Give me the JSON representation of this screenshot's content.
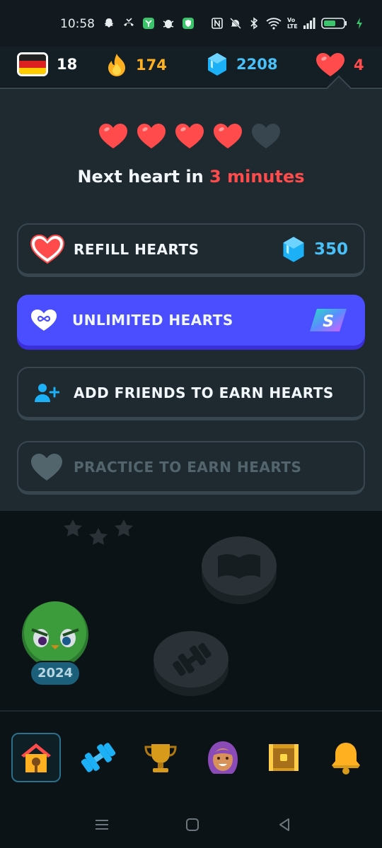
{
  "status_bar": {
    "time": "10:58",
    "lte_label": "Vo LTE"
  },
  "stats": {
    "course_flag": "German flag",
    "course_count": "18",
    "streak": "174",
    "gems": "2208",
    "hearts": "4"
  },
  "hearts_panel": {
    "filled_hearts": 4,
    "total_hearts": 5,
    "next_heart_prefix": "Next heart in ",
    "next_heart_time": "3 minutes",
    "options": {
      "refill": {
        "label": "REFILL HEARTS",
        "cost": "350"
      },
      "unlimited": {
        "label": "UNLIMITED HEARTS",
        "badge": "S"
      },
      "friends": {
        "label": "ADD FRIENDS TO EARN HEARTS"
      },
      "practice": {
        "label": "PRACTICE TO EARN HEARTS"
      }
    }
  },
  "path": {
    "year_badge": "2024"
  },
  "colors": {
    "heart_red": "#ff4b4b",
    "gem_blue": "#49c0f8",
    "streak_orange": "#ffb020",
    "super_purple": "#4b4eff",
    "panel_bg": "#1e2a30"
  },
  "bottom_nav": [
    "home-icon",
    "practice-dumbbell-icon",
    "leaderboard-trophy-icon",
    "profile-avatar-icon",
    "chest-icon",
    "notifications-bell-icon"
  ]
}
